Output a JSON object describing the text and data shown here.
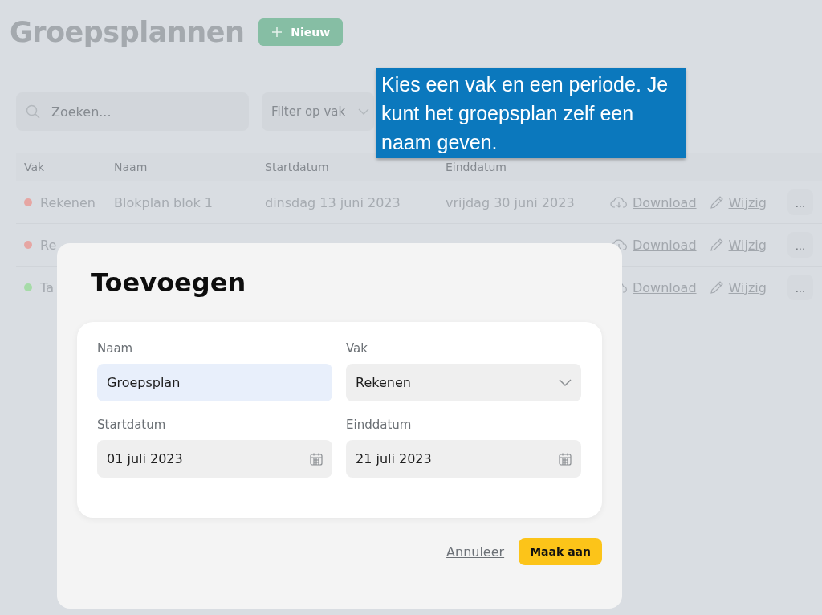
{
  "page": {
    "title": "Groepsplannen",
    "new_button": "Nieuw"
  },
  "search": {
    "placeholder": "Zoeken..."
  },
  "filter": {
    "placeholder": "Filter op vak"
  },
  "table": {
    "columns": [
      "Vak",
      "Naam",
      "Startdatum",
      "Einddatum"
    ],
    "rows": [
      {
        "vak": "Rekenen",
        "color": "#e6a6a3",
        "naam": "Blokplan blok 1",
        "start": "dinsdag 13 juni 2023",
        "end": "vrijdag 30 juni 2023",
        "download": "Download",
        "edit": "Wijzig",
        "more": "..."
      },
      {
        "vak": "Re",
        "color": "#e6a6a3",
        "download": "Download",
        "edit": "Wijzig",
        "more": "..."
      },
      {
        "vak": "Ta",
        "color": "#a6dba8",
        "download": "Download",
        "edit": "Wijzig",
        "more": "..."
      }
    ]
  },
  "tooltip": {
    "text": "Kies een vak en een periode. Je kunt het groepsplan zelf een naam geven."
  },
  "dialog": {
    "title": "Toevoegen",
    "fields": [
      {
        "kind": "text",
        "label": "Naam",
        "value": "Groepsplan",
        "focused": true
      },
      {
        "kind": "select",
        "label": "Vak",
        "value": "Rekenen",
        "focused": false
      },
      {
        "kind": "date",
        "label": "Startdatum",
        "value": "01 juli 2023",
        "focused": false
      },
      {
        "kind": "date",
        "label": "Einddatum",
        "value": "21 juli 2023",
        "focused": false
      }
    ],
    "cancel": "Annuleer",
    "submit": "Maak aan"
  }
}
